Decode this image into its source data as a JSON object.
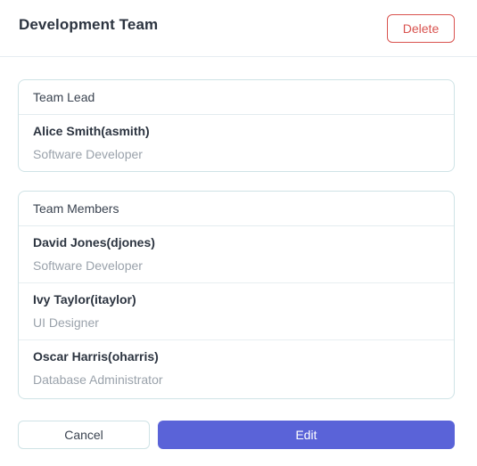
{
  "header": {
    "title": "Development Team",
    "delete_label": "Delete"
  },
  "team_lead": {
    "section_title": "Team Lead",
    "members": [
      {
        "name": "Alice Smith(asmith)",
        "role": "Software Developer"
      }
    ]
  },
  "team_members": {
    "section_title": "Team Members",
    "members": [
      {
        "name": "David Jones(djones)",
        "role": "Software Developer"
      },
      {
        "name": "Ivy Taylor(itaylor)",
        "role": "UI Designer"
      },
      {
        "name": "Oscar Harris(oharris)",
        "role": "Database Administrator"
      }
    ]
  },
  "footer": {
    "cancel_label": "Cancel",
    "edit_label": "Edit"
  },
  "colors": {
    "accent": "#5a63d8",
    "danger": "#d9534f",
    "border": "#cfe3e6"
  }
}
